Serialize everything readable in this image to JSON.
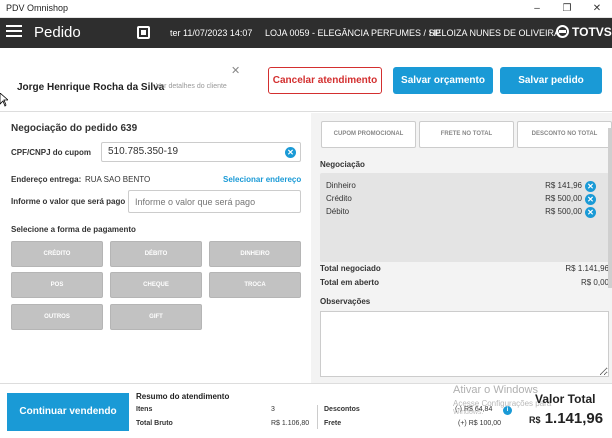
{
  "window": {
    "title": "PDV Omnishop",
    "minimize_icon": "minimize-icon",
    "restore_icon": "restore-icon",
    "close_icon": "close-icon"
  },
  "header": {
    "title": "Pedido",
    "date": "ter 11/07/2023 14:07",
    "store": "LOJA 0059 - ELEGÂNCIA PERFUMES / SP",
    "user": "HELOIZA NUNES DE OLIVEIRA",
    "brand": "TOTVS"
  },
  "customer": {
    "name": "Jorge Henrique Rocha da Silva",
    "details_link": "Ver detalhes do cliente",
    "cancel_label": "Cancelar atendimento",
    "save_budget_label": "Salvar orçamento",
    "save_order_label": "Salvar pedido"
  },
  "negotiation": {
    "title": "Negociação do pedido 639",
    "cpf_label": "CPF/CNPJ do cupom",
    "cpf_value": "510.785.350-19",
    "address_label": "Endereço entrega:",
    "address_value": "RUA SAO BENTO",
    "address_link": "Selecionar endereço",
    "amount_label": "Informe o valor que será pago",
    "amount_placeholder": "Informe o valor que será pago",
    "payment_title": "Selecione a forma de pagamento",
    "payment_methods": [
      "CRÉDITO",
      "DÉBITO",
      "DINHEIRO",
      "POS",
      "CHEQUE",
      "TROCA",
      "OUTROS",
      "GIFT"
    ]
  },
  "summary_panel": {
    "promo_buttons": [
      "CUPOM PROMOCIONAL",
      "FRETE NO TOTAL",
      "DESCONTO NO TOTAL"
    ],
    "negotiation_title": "Negociação",
    "payments": [
      {
        "method": "Dinheiro",
        "value": "R$ 141,96"
      },
      {
        "method": "Crédito",
        "value": "R$ 500,00"
      },
      {
        "method": "Débito",
        "value": "R$ 500,00"
      }
    ],
    "total_negotiated_label": "Total negociado",
    "total_negotiated_value": "R$ 1.141,96",
    "total_open_label": "Total em aberto",
    "total_open_value": "R$ 0,00",
    "notes_label": "Observações"
  },
  "footer": {
    "continue_label": "Continuar vendendo",
    "summary_title": "Resumo do atendimento",
    "items_label": "Itens",
    "items_value": "3",
    "gross_label": "Total Bruto",
    "gross_value": "R$ 1.106,80",
    "discount_label": "Descontos",
    "discount_value": "(-) R$ 64,84",
    "shipping_label": "Frete",
    "shipping_value": "(+) R$ 100,00",
    "total_label": "Valor Total",
    "total_currency": "R$",
    "total_value": "1.141,96",
    "watermark_title": "Ativar o Windows",
    "watermark_sub": "Acesse Configurações para",
    "watermark_sub2": "Windows."
  }
}
